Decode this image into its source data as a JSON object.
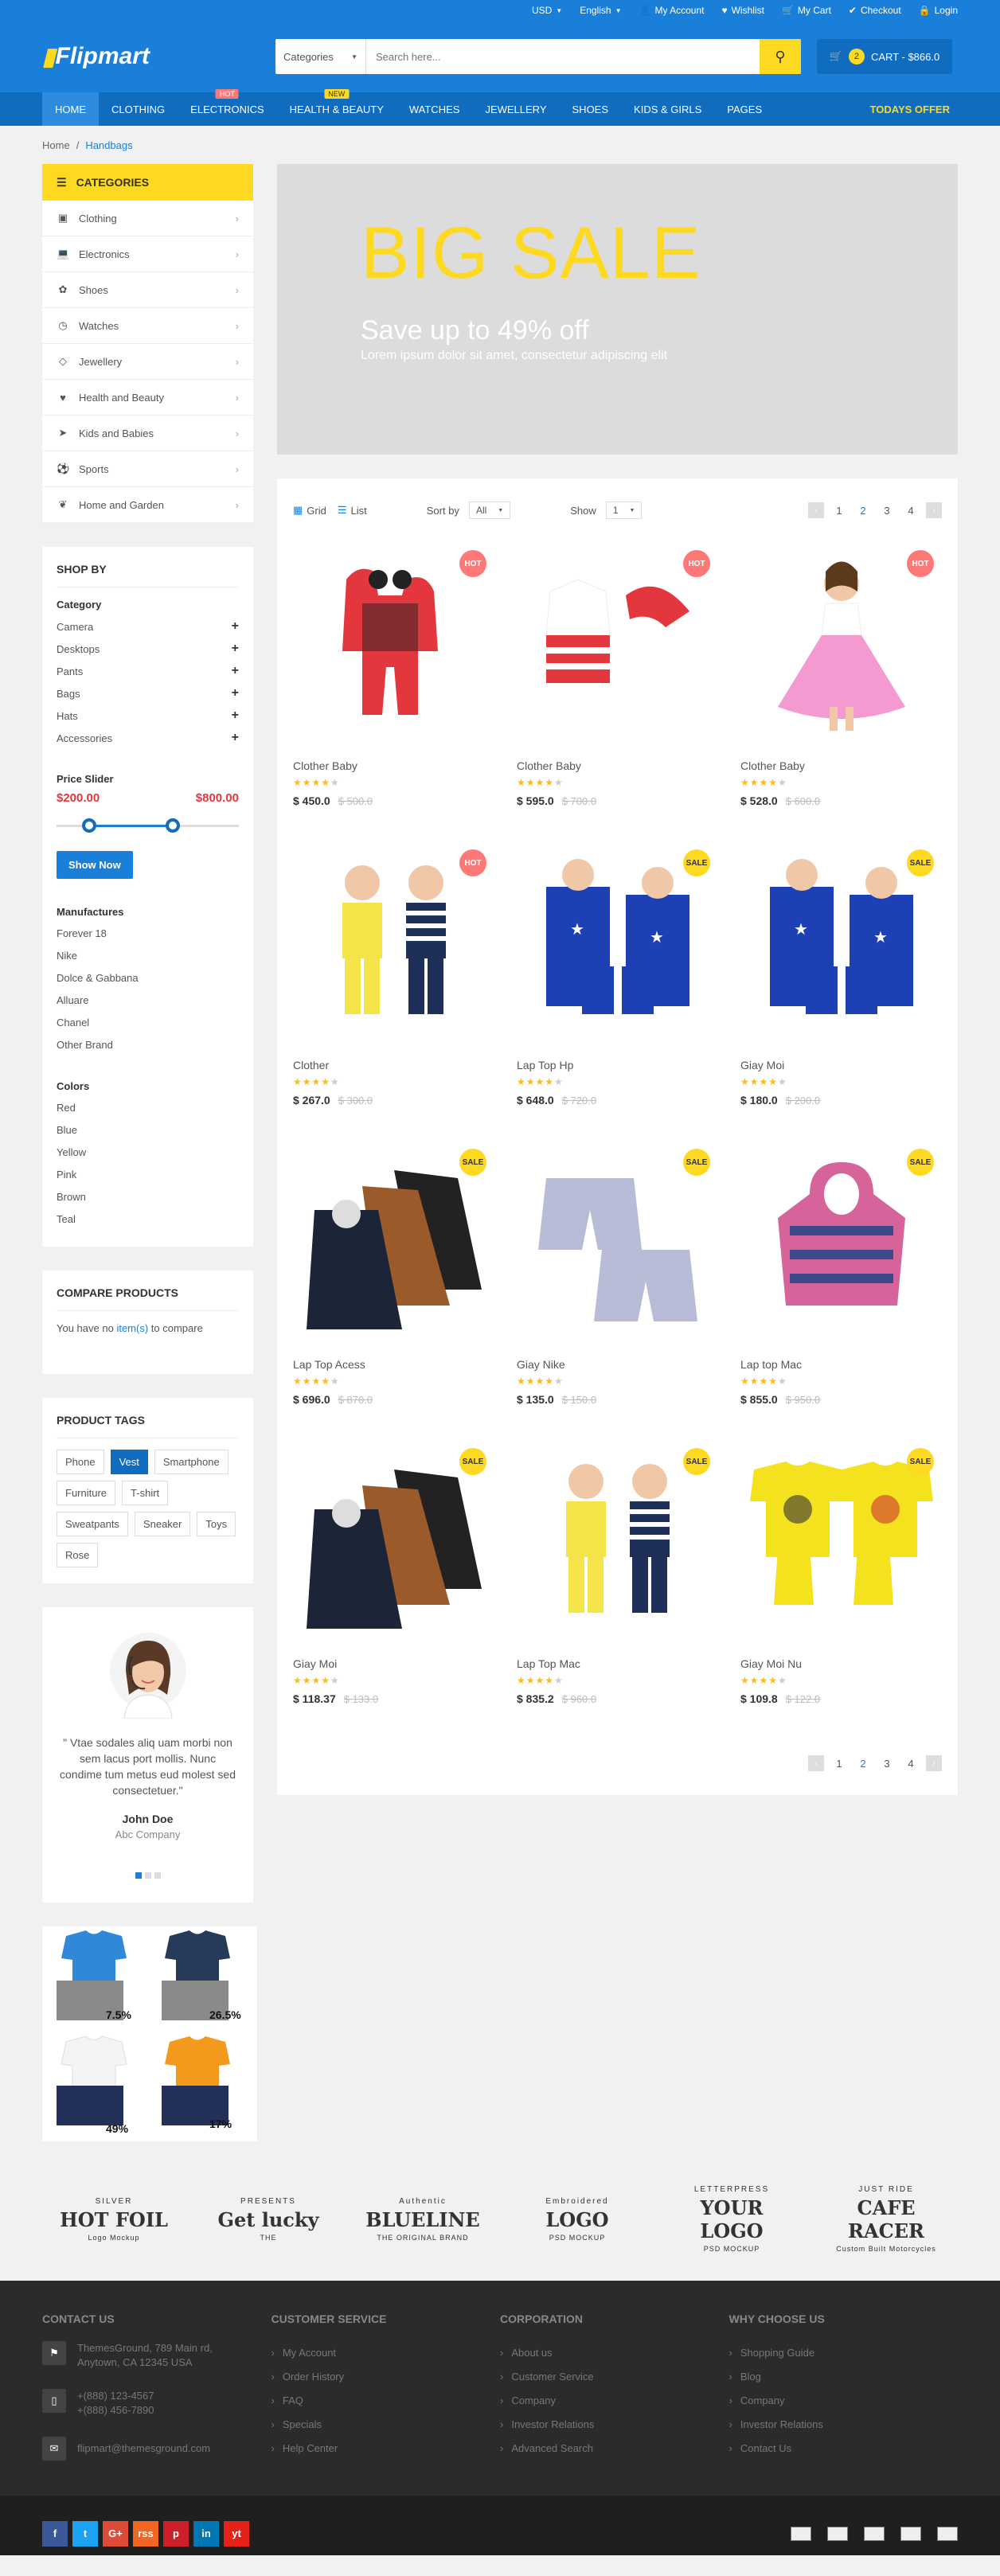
{
  "topbar": {
    "currency": "USD",
    "language": "English",
    "links": [
      "My Account",
      "Wishlist",
      "My Cart",
      "Checkout",
      "Login"
    ]
  },
  "header": {
    "logo_text": "Flipmart",
    "search_category": "Categories",
    "search_placeholder": "Search here...",
    "cart_count": "2",
    "cart_label": "CART - $866.0"
  },
  "nav": {
    "items": [
      {
        "label": "Home",
        "badge": ""
      },
      {
        "label": "Clothing",
        "badge": ""
      },
      {
        "label": "Electronics",
        "badge": "HOT"
      },
      {
        "label": "Health & Beauty",
        "badge": "NEW"
      },
      {
        "label": "Watches",
        "badge": ""
      },
      {
        "label": "Jewellery",
        "badge": ""
      },
      {
        "label": "Shoes",
        "badge": ""
      },
      {
        "label": "Kids & Girls",
        "badge": ""
      },
      {
        "label": "Pages",
        "badge": ""
      }
    ],
    "offer": "TODAYS OFFER"
  },
  "breadcrumb": {
    "home": "Home",
    "sep": "/",
    "current": "Handbags"
  },
  "categories": {
    "title": "CATEGORIES",
    "items": [
      {
        "label": "Clothing",
        "icon": "shopping-bag-icon"
      },
      {
        "label": "Electronics",
        "icon": "laptop-icon"
      },
      {
        "label": "Shoes",
        "icon": "paw-icon"
      },
      {
        "label": "Watches",
        "icon": "clock-icon"
      },
      {
        "label": "Jewellery",
        "icon": "diamond-icon"
      },
      {
        "label": "Health and Beauty",
        "icon": "heartbeat-icon"
      },
      {
        "label": "Kids and Babies",
        "icon": "paper-plane-icon"
      },
      {
        "label": "Sports",
        "icon": "futbol-icon"
      },
      {
        "label": "Home and Garden",
        "icon": "envira-icon"
      }
    ]
  },
  "shopby": {
    "title": "SHOP BY",
    "category_title": "Category",
    "category_items": [
      "Camera",
      "Desktops",
      "Pants",
      "Bags",
      "Hats",
      "Accessories"
    ],
    "price_title": "Price Slider",
    "price_min": "$200.00",
    "price_max": "$800.00",
    "show_now": "Show Now",
    "manufactures_title": "Manufactures",
    "manufactures": [
      "Forever 18",
      "Nike",
      "Dolce & Gabbana",
      "Alluare",
      "Chanel",
      "Other Brand"
    ],
    "colors_title": "Colors",
    "colors": [
      "Red",
      "Blue",
      "Yellow",
      "Pink",
      "Brown",
      "Teal"
    ]
  },
  "compare": {
    "title": "COMPARE PRODUCTS",
    "text_before": "You have no ",
    "link": "item(s)",
    "text_after": " to compare"
  },
  "tags": {
    "title": "PRODUCT TAGS",
    "items": [
      "Phone",
      "Vest",
      "Smartphone",
      "Furniture",
      "T-shirt",
      "Sweatpants",
      "Sneaker",
      "Toys",
      "Rose"
    ],
    "active": "Vest"
  },
  "testimonial": {
    "quote": "\" Vtae sodales aliq uam morbi non sem lacus port mollis. Nunc condime tum metus eud molest sed consectetuer.\"",
    "name": "John Doe",
    "company": "Abc Company"
  },
  "promo": {
    "tags": [
      "7.5%",
      "26.5%",
      "49%",
      "17%"
    ]
  },
  "banner": {
    "title": "BIG SALE",
    "subtitle": "Save up to 49% off",
    "text": "Lorem ipsum dolor sit amet, consectetur adipiscing elit"
  },
  "toolbar": {
    "grid": "Grid",
    "list": "List",
    "sortby_label": "Sort by",
    "sortby_value": "All",
    "show_label": "Show",
    "show_value": "1",
    "pages": [
      "1",
      "2",
      "3",
      "4"
    ],
    "current_page": "2"
  },
  "products": [
    {
      "name": "Clother Baby",
      "price": "$ 450.0",
      "old": "$ 500.0",
      "badge": "HOT",
      "rating": 4
    },
    {
      "name": "Clother Baby",
      "price": "$ 595.0",
      "old": "$ 700.0",
      "badge": "HOT",
      "rating": 4
    },
    {
      "name": "Clother Baby",
      "price": "$ 528.0",
      "old": "$ 600.0",
      "badge": "HOT",
      "rating": 4
    },
    {
      "name": "Clother",
      "price": "$ 267.0",
      "old": "$ 300.0",
      "badge": "HOT",
      "rating": 4
    },
    {
      "name": "Lap Top Hp",
      "price": "$ 648.0",
      "old": "$ 720.0",
      "badge": "SALE",
      "rating": 4
    },
    {
      "name": "Giay Moi",
      "price": "$ 180.0",
      "old": "$ 200.0",
      "badge": "SALE",
      "rating": 4
    },
    {
      "name": "Lap Top Acess",
      "price": "$ 696.0",
      "old": "$ 870.0",
      "badge": "SALE",
      "rating": 4
    },
    {
      "name": "Giay Nike",
      "price": "$ 135.0",
      "old": "$ 150.0",
      "badge": "SALE",
      "rating": 4
    },
    {
      "name": "Lap top Mac",
      "price": "$ 855.0",
      "old": "$ 950.0",
      "badge": "SALE",
      "rating": 4
    },
    {
      "name": "Giay Moi",
      "price": "$ 118.37",
      "old": "$ 133.0",
      "badge": "SALE",
      "rating": 4
    },
    {
      "name": "Lap Top Mac",
      "price": "$ 835.2",
      "old": "$ 960.0",
      "badge": "SALE",
      "rating": 4
    },
    {
      "name": "Giay Moi Nu",
      "price": "$ 109.8",
      "old": "$ 122.0",
      "badge": "SALE",
      "rating": 4
    }
  ],
  "brands": [
    {
      "top": "SILVER",
      "main": "HOT FOIL",
      "sub": "Logo Mockup"
    },
    {
      "top": "PRESENTS",
      "main": "Get lucky",
      "sub": "THE"
    },
    {
      "top": "Authentic",
      "main": "BLUELINE",
      "sub": "THE ORIGINAL BRAND"
    },
    {
      "top": "Embroidered",
      "main": "LOGO",
      "sub": "PSD MOCKUP"
    },
    {
      "top": "LETTERPRESS",
      "main": "YOUR LOGO",
      "sub": "PSD MOCKUP"
    },
    {
      "top": "JUST RIDE",
      "main": "CAFE RACER",
      "sub": "Custom Built Motorcycles"
    }
  ],
  "footer": {
    "contact_title": "CONTACT US",
    "address": "ThemesGround, 789 Main rd, Anytown, CA 12345 USA",
    "phone1": "+(888) 123-4567",
    "phone2": "+(888) 456-7890",
    "email": "flipmart@themesground.com",
    "cols": [
      {
        "title": "CUSTOMER SERVICE",
        "items": [
          "My Account",
          "Order History",
          "FAQ",
          "Specials",
          "Help Center"
        ]
      },
      {
        "title": "CORPORATION",
        "items": [
          "About us",
          "Customer Service",
          "Company",
          "Investor Relations",
          "Advanced Search"
        ]
      },
      {
        "title": "WHY CHOOSE US",
        "items": [
          "Shopping Guide",
          "Blog",
          "Company",
          "Investor Relations",
          "Contact Us"
        ]
      }
    ],
    "social": [
      "f",
      "t",
      "G+",
      "rss",
      "p",
      "in",
      "yt"
    ]
  },
  "colors": {
    "primary": "#1a7fd8",
    "dark_blue": "#0f6cbf",
    "yellow": "#fdd922",
    "hot": "#ff7878",
    "footer": "#2b2b2b"
  }
}
